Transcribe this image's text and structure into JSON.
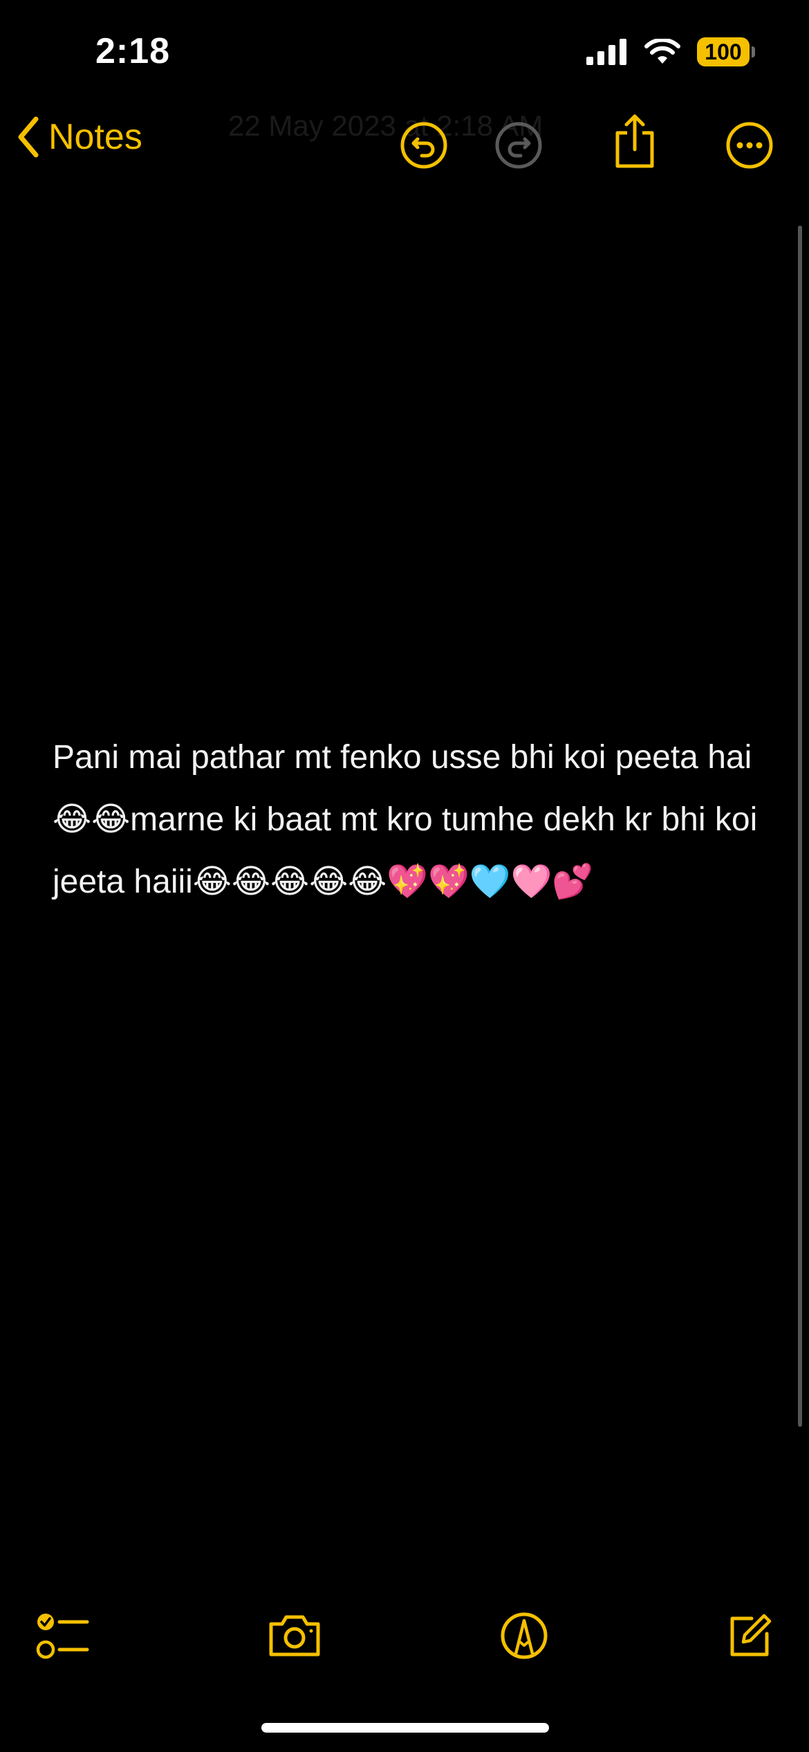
{
  "status_bar": {
    "time": "2:18",
    "battery": "100",
    "icons": [
      "cellular-signal-icon",
      "wifi-icon",
      "battery-icon"
    ]
  },
  "nav": {
    "back_label": "Notes",
    "date_text": "22 May 2023 at 2:18 AM",
    "accent_color": "#F5C000",
    "buttons": [
      "undo-icon",
      "redo-icon",
      "share-icon",
      "more-icon"
    ]
  },
  "note": {
    "body": "Pani mai pathar mt fenko usse bhi koi peeta hai😂😂marne ki baat mt kro tumhe dekh kr bhi koi jeeta haiii😂😂😂😂😂💖💖🩵🩷💕"
  },
  "toolbar": {
    "buttons": [
      "checklist-icon",
      "camera-icon",
      "markup-pen-icon",
      "compose-icon"
    ]
  }
}
